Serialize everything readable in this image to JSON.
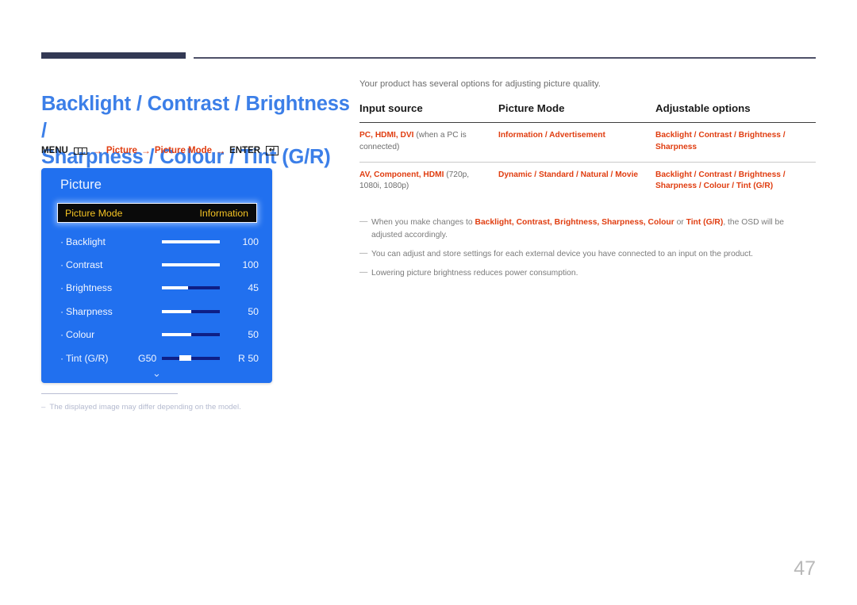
{
  "header": {
    "rule_thick_color": "#333954",
    "rule_thin_color": "#4e5068"
  },
  "page": {
    "title_line1": "Backlight / Contrast / Brightness /",
    "title_line2": "Sharpness / Colour / Tint (G/R)",
    "title_color": "#3c7fe8",
    "page_number": "47"
  },
  "breadcrumb": {
    "menu_label": "MENU",
    "menu_icon": "menu-bars-icon",
    "arrow": "→",
    "step1": "Picture",
    "step2": "Picture Mode",
    "enter_label": "ENTER",
    "enter_icon": "enter-key-icon",
    "enter_glyph": "↵",
    "accent_color": "#e03d10"
  },
  "osd": {
    "title": "Picture",
    "panel_color": "#2170ef",
    "selected_row": {
      "label": "Picture Mode",
      "value": "Information",
      "text_color": "#f4c323",
      "bg_color": "#0a0a0a"
    },
    "rows": [
      {
        "bullet": "·",
        "label": "Backlight",
        "value": "100",
        "fill_pct": 100,
        "type": "bar"
      },
      {
        "bullet": "·",
        "label": "Contrast",
        "value": "100",
        "fill_pct": 100,
        "type": "bar"
      },
      {
        "bullet": "·",
        "label": "Brightness",
        "value": "45",
        "fill_pct": 45,
        "type": "bar"
      },
      {
        "bullet": "·",
        "label": "Sharpness",
        "value": "50",
        "fill_pct": 50,
        "type": "bar"
      },
      {
        "bullet": "·",
        "label": "Colour",
        "value": "50",
        "fill_pct": 50,
        "type": "bar"
      },
      {
        "bullet": "·",
        "label": "Tint (G/R)",
        "value": "R 50",
        "left_value": "G50",
        "handle_pct": 40,
        "type": "handle"
      }
    ],
    "scroll_chevron": "⌄",
    "footnote_dash": "–",
    "footnote": "The displayed image may differ depending on the model."
  },
  "content": {
    "intro": "Your product has several options for adjusting picture quality.",
    "table": {
      "headers": [
        "Input source",
        "Picture Mode",
        "Adjustable options"
      ],
      "rows": [
        {
          "input_source_bold": "PC, HDMI, DVI",
          "input_source_plain": " (when a PC is connected)",
          "picture_mode": "Information / Advertisement",
          "adjustable_options": "Backlight / Contrast / Brightness / Sharpness"
        },
        {
          "input_source_bold": "AV, Component, HDMI",
          "input_source_plain": " (720p, 1080i, 1080p)",
          "picture_mode": "Dynamic / Standard / Natural / Movie",
          "adjustable_options": "Backlight / Contrast / Brightness / Sharpness / Colour / Tint (G/R)"
        }
      ]
    },
    "notes": [
      {
        "dash": "—",
        "pre": "When you make changes to ",
        "bold": "Backlight, Contrast, Brightness, Sharpness, Colour",
        "mid": " or ",
        "bold2": "Tint (G/R)",
        "post": ", the OSD will be adjusted accordingly."
      },
      {
        "dash": "—",
        "text": "You can adjust and store settings for each external device you have connected to an input on the product."
      },
      {
        "dash": "—",
        "text": "Lowering picture brightness reduces power consumption."
      }
    ]
  }
}
